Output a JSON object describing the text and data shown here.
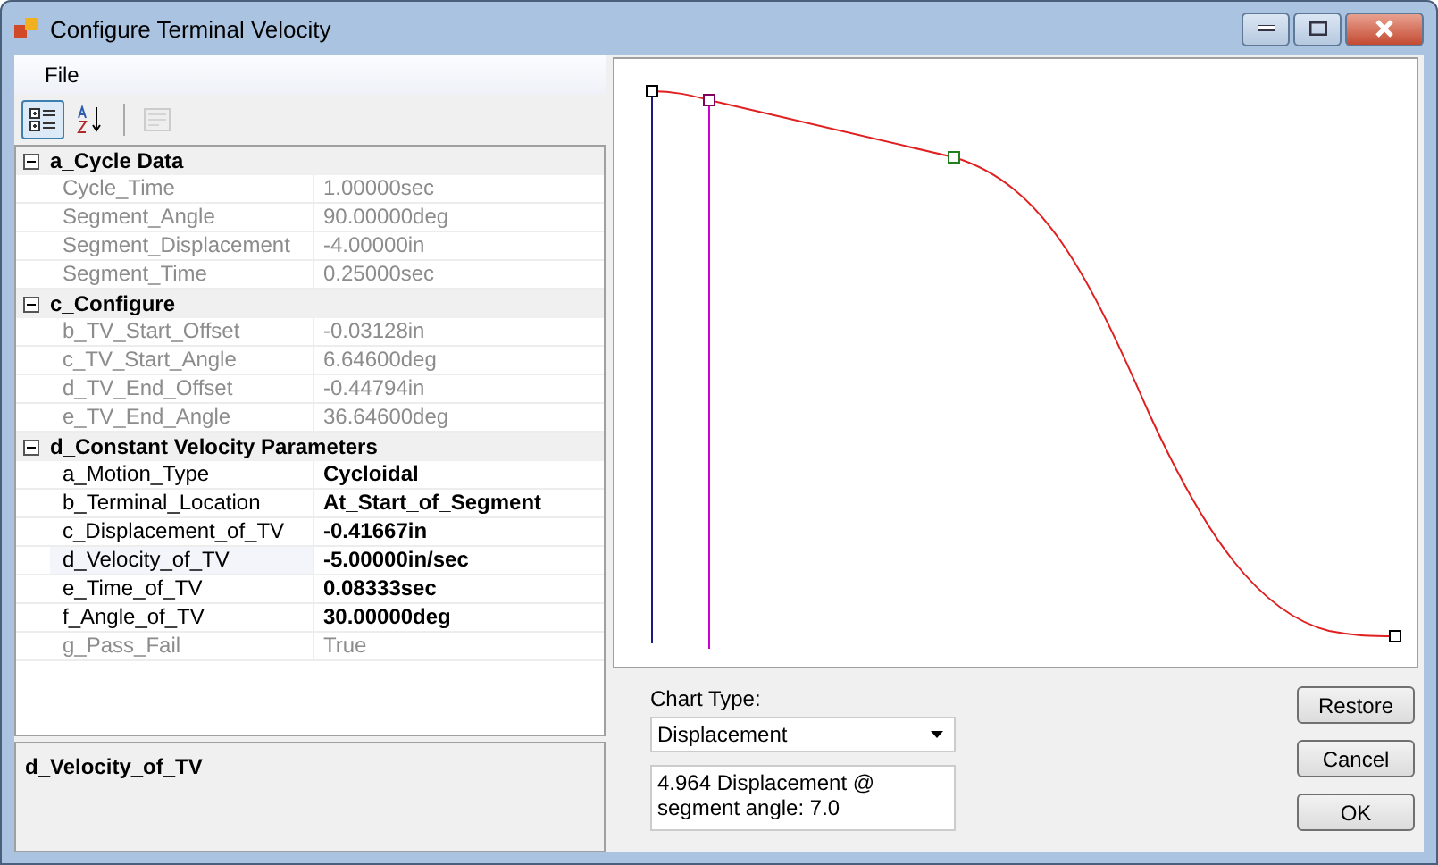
{
  "window": {
    "title": "Configure Terminal Velocity"
  },
  "menu": [
    {
      "label": "File"
    }
  ],
  "toolbar": [
    {
      "kind": "categorized",
      "selected": true
    },
    {
      "kind": "alphabetical",
      "selected": false
    },
    {
      "kind": "pages",
      "disabled": true
    }
  ],
  "categories": [
    {
      "name": "a_Cycle Data",
      "expanded": true,
      "properties": [
        {
          "name": "Cycle_Time",
          "value": "1.00000sec",
          "readonly": true,
          "modified": false,
          "selected": false
        },
        {
          "name": "Segment_Angle",
          "value": "90.00000deg",
          "readonly": true,
          "modified": false,
          "selected": false
        },
        {
          "name": "Segment_Displacement",
          "value": "-4.00000in",
          "readonly": true,
          "modified": false,
          "selected": false
        },
        {
          "name": "Segment_Time",
          "value": "0.25000sec",
          "readonly": true,
          "modified": false,
          "selected": false
        }
      ]
    },
    {
      "name": "c_Configure",
      "expanded": true,
      "properties": [
        {
          "name": "b_TV_Start_Offset",
          "value": "-0.03128in",
          "readonly": true,
          "modified": false,
          "selected": false
        },
        {
          "name": "c_TV_Start_Angle",
          "value": "6.64600deg",
          "readonly": true,
          "modified": false,
          "selected": false
        },
        {
          "name": "d_TV_End_Offset",
          "value": "-0.44794in",
          "readonly": true,
          "modified": false,
          "selected": false
        },
        {
          "name": "e_TV_End_Angle",
          "value": "36.64600deg",
          "readonly": true,
          "modified": false,
          "selected": false
        }
      ]
    },
    {
      "name": "d_Constant Velocity Parameters",
      "expanded": true,
      "properties": [
        {
          "name": "a_Motion_Type",
          "value": "Cycloidal",
          "readonly": false,
          "modified": true,
          "selected": false
        },
        {
          "name": "b_Terminal_Location",
          "value": "At_Start_of_Segment",
          "readonly": false,
          "modified": true,
          "selected": false
        },
        {
          "name": "c_Displacement_of_TV",
          "value": "-0.41667in",
          "readonly": false,
          "modified": true,
          "selected": false
        },
        {
          "name": "d_Velocity_of_TV",
          "value": "-5.00000in/sec",
          "readonly": false,
          "modified": true,
          "selected": true
        },
        {
          "name": "e_Time_of_TV",
          "value": "0.08333sec",
          "readonly": false,
          "modified": true,
          "selected": false
        },
        {
          "name": "f_Angle_of_TV",
          "value": "30.00000deg",
          "readonly": false,
          "modified": true,
          "selected": false
        },
        {
          "name": "g_Pass_Fail",
          "value": "True",
          "readonly": true,
          "modified": false,
          "selected": false
        }
      ]
    }
  ],
  "help": {
    "title": "d_Velocity_of_TV"
  },
  "chart_type": {
    "label": "Chart Type:",
    "value": "Displacement"
  },
  "readout": "4.964 Displacement @ segment angle: 7.0",
  "buttons": [
    {
      "label": "Restore"
    },
    {
      "label": "Cancel"
    },
    {
      "label": "OK"
    }
  ]
}
